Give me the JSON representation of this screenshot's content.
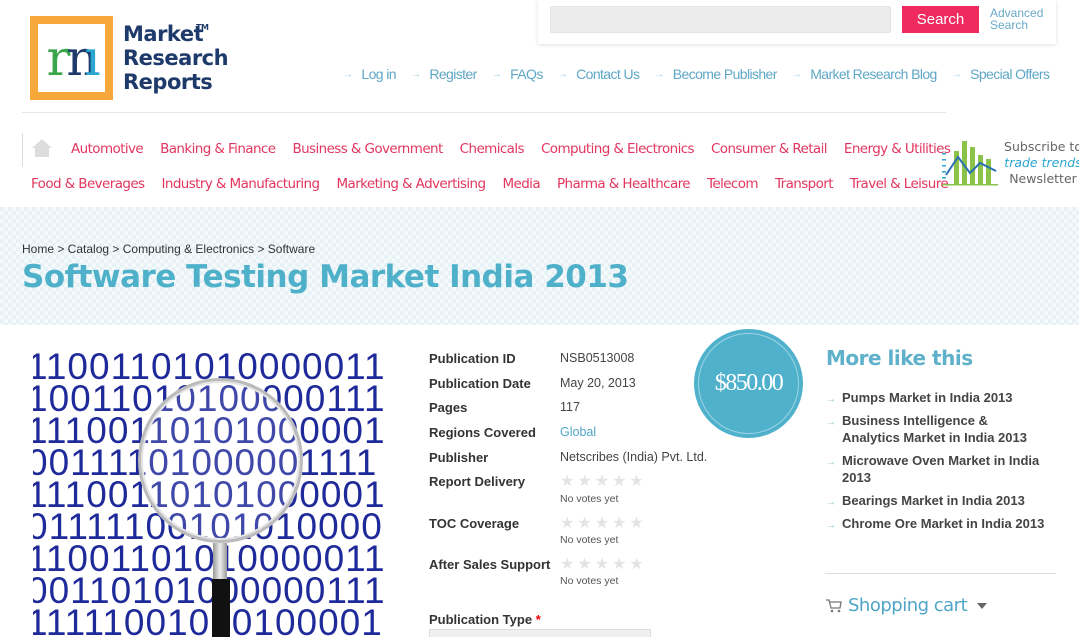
{
  "brand": {
    "logo_letter": "m",
    "name_lines": [
      "Market",
      "Research",
      "Reports"
    ],
    "trademark": "TM"
  },
  "search": {
    "placeholder": "",
    "value": "",
    "button_label": "Search",
    "advanced_label": "Advanced Search"
  },
  "top_links": [
    "Log in",
    "Register",
    "FAQs",
    "Contact Us",
    "Become Publisher",
    "Market Research Blog",
    "Special Offers"
  ],
  "categories": {
    "row1": [
      "Automotive",
      "Banking & Finance",
      "Business & Government",
      "Chemicals",
      "Computing & Electronics",
      "Consumer & Retail",
      "Energy & Utilities"
    ],
    "row2": [
      "Food & Beverages",
      "Industry & Manufacturing",
      "Marketing & Advertising",
      "Media",
      "Pharma & Healthcare",
      "Telecom",
      "Transport",
      "Travel & Leisure"
    ]
  },
  "newsletter": {
    "line1": "Subscribe to",
    "line2": "trade trends",
    "line3": "Newsletter"
  },
  "breadcrumb": "Home > Catalog > Computing & Electronics > Software",
  "page_title": "Software Testing Market India 2013",
  "product_image": {
    "binary_rows": [
      "11001101010000011",
      "10011010100000111",
      "11100110101000001",
      "00111101000001111",
      "11100110101000001",
      "01111100101010000",
      "11001101010000011",
      "00110101000000111",
      "11111001010100001"
    ]
  },
  "details": {
    "publication_id": {
      "label": "Publication ID",
      "value": "NSB0513008"
    },
    "publication_date": {
      "label": "Publication Date",
      "value": "May 20, 2013"
    },
    "pages": {
      "label": "Pages",
      "value": "117"
    },
    "regions": {
      "label": "Regions Covered",
      "value": "Global"
    },
    "publisher": {
      "label": "Publisher",
      "value": "Netscribes (India) Pvt. Ltd."
    },
    "ratings": [
      {
        "label": "Report Delivery",
        "stars": 0,
        "max": 5,
        "note": "No votes yet"
      },
      {
        "label": "TOC Coverage",
        "stars": 0,
        "max": 5,
        "note": "No votes yet"
      },
      {
        "label": "After Sales Support",
        "stars": 0,
        "max": 5,
        "note": "No votes yet"
      }
    ],
    "publication_type": {
      "label": "Publication Type",
      "required_mark": "*",
      "selected": ""
    }
  },
  "price": "$850.00",
  "more_like_this": {
    "title": "More like this",
    "items": [
      "Pumps Market in India 2013",
      "Business Intelligence & Analytics Market in India 2013",
      "Microwave Oven Market in India 2013",
      "Bearings Market in India 2013",
      "Chrome Ore Market in India 2013"
    ]
  },
  "cart": {
    "title": "Shopping cart"
  },
  "colors": {
    "accent_pink": "#ee2a5f",
    "category_red": "#e2365f",
    "link_blue": "#5fa7c6",
    "title_teal": "#4fb0ca",
    "logo_orange": "#f7a83a",
    "logo_navy": "#1d3a6b"
  }
}
